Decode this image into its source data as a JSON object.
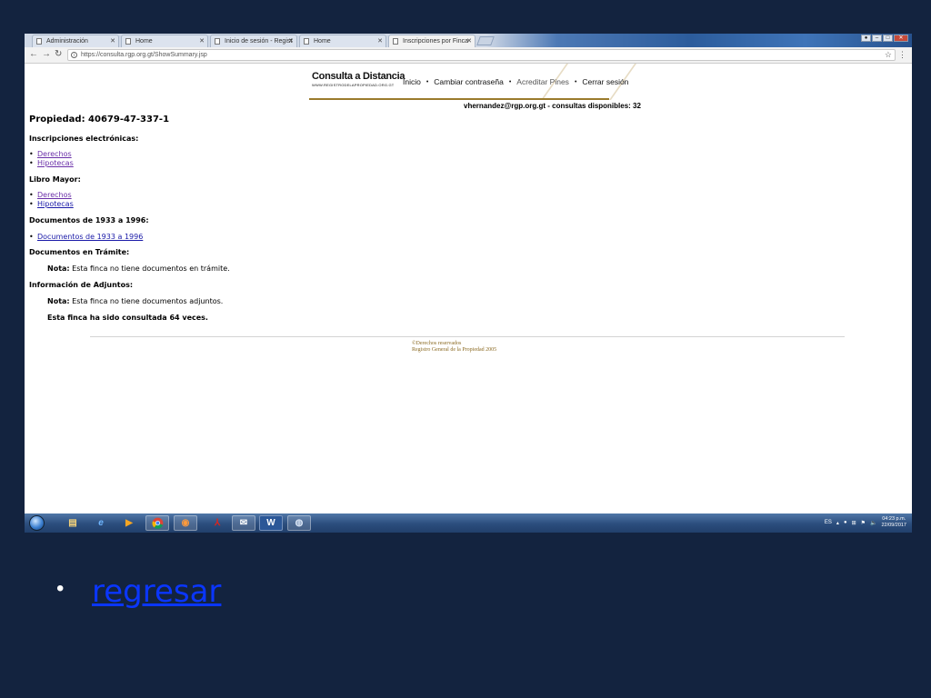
{
  "browser": {
    "tabs": [
      {
        "label": "Administración",
        "active": false
      },
      {
        "label": "Home",
        "active": false
      },
      {
        "label": "Inicio de sesión - Regist",
        "active": false
      },
      {
        "label": "Home",
        "active": false
      },
      {
        "label": "Inscripciones por Finca",
        "active": true
      }
    ],
    "url": "https://consulta.rgp.org.gt/ShowSummary.jsp"
  },
  "site": {
    "logo_text": "Consulta a Distancia",
    "logo_sub": "WWW.REGISTRODELAPROPIEDAD.ORG.GT",
    "nav": [
      "Inicio",
      "Cambiar contraseña",
      "Acreditar Pines",
      "Cerrar sesión"
    ],
    "user_line": "vhernandez@rgp.org.gt - consultas disponibles: 32"
  },
  "summary": {
    "property_title": "Propiedad: 40679-47-337-1",
    "electronic_heading": "Inscripciones electrónicas:",
    "electronic_links": [
      "Derechos",
      "Hipotecas"
    ],
    "ledger_heading": "Libro Mayor:",
    "ledger_links": [
      "Derechos",
      "Hipotecas"
    ],
    "docs_heading": "Documentos de 1933 a 1996:",
    "docs_link": "Documentos de 1933 a 1996",
    "pending_heading": "Documentos en Trámite:",
    "pending_note_label": "Nota:",
    "pending_note_text": " Esta finca no tiene documentos en trámite.",
    "attach_heading": "Información de Adjuntos:",
    "attach_note_label": "Nota:",
    "attach_note_text": " Esta finca no tiene documentos adjuntos.",
    "consult_count": "Esta finca ha sido consultada 64 veces."
  },
  "footer": {
    "line1": "©Derechos reservados",
    "line2": "Registro General de la Propiedad 2005"
  },
  "taskbar": {
    "lang": "ES",
    "time": "04:23 p.m.",
    "date": "22/09/2017"
  },
  "slide": {
    "back_link": "regresar"
  }
}
